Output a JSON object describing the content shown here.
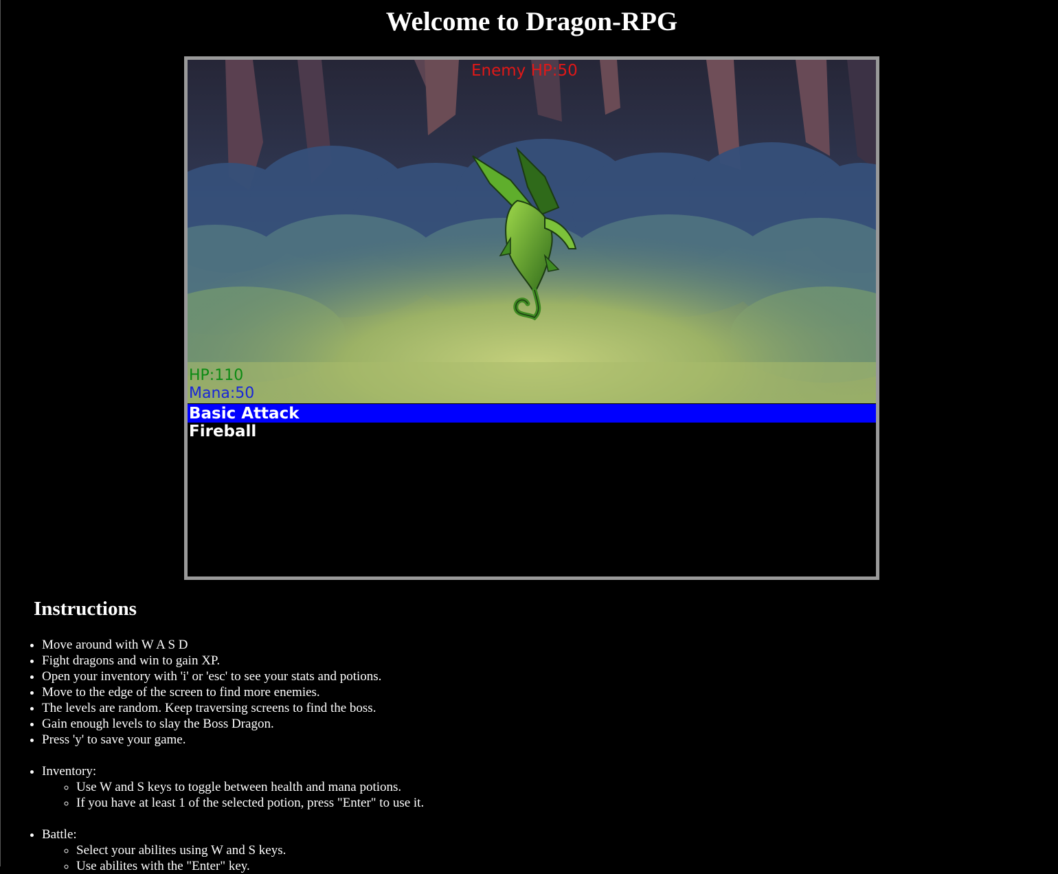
{
  "page": {
    "title": "Welcome to Dragon-RPG"
  },
  "game": {
    "enemy_hp": "Enemy HP:50",
    "player_hp": "HP:110",
    "player_mana": "Mana:50",
    "abilities": [
      "Basic Attack",
      "Fireball"
    ],
    "selected_ability": "Basic Attack",
    "scene": "forest",
    "enemy": "green-dragon-sprite"
  },
  "instructions": {
    "title": "Instructions",
    "general": [
      "Move around with W A S D",
      "Fight dragons and win to gain XP.",
      "Open your inventory with 'i' or 'esc' to see your stats and potions.",
      "Move to the edge of the screen to find more enemies.",
      "The levels are random. Keep traversing screens to find the boss.",
      "Gain enough levels to slay the Boss Dragon.",
      "Press 'y' to save your game."
    ],
    "inventory": {
      "label": "Inventory:",
      "items": [
        "Use W and S keys to toggle between health and mana potions.",
        "If you have at least 1 of the selected potion, press \"Enter\" to use it."
      ]
    },
    "battle": {
      "label": "Battle:",
      "items": [
        "Select your abilites using W and S keys.",
        "Use abilites with the \"Enter\" key."
      ]
    }
  }
}
